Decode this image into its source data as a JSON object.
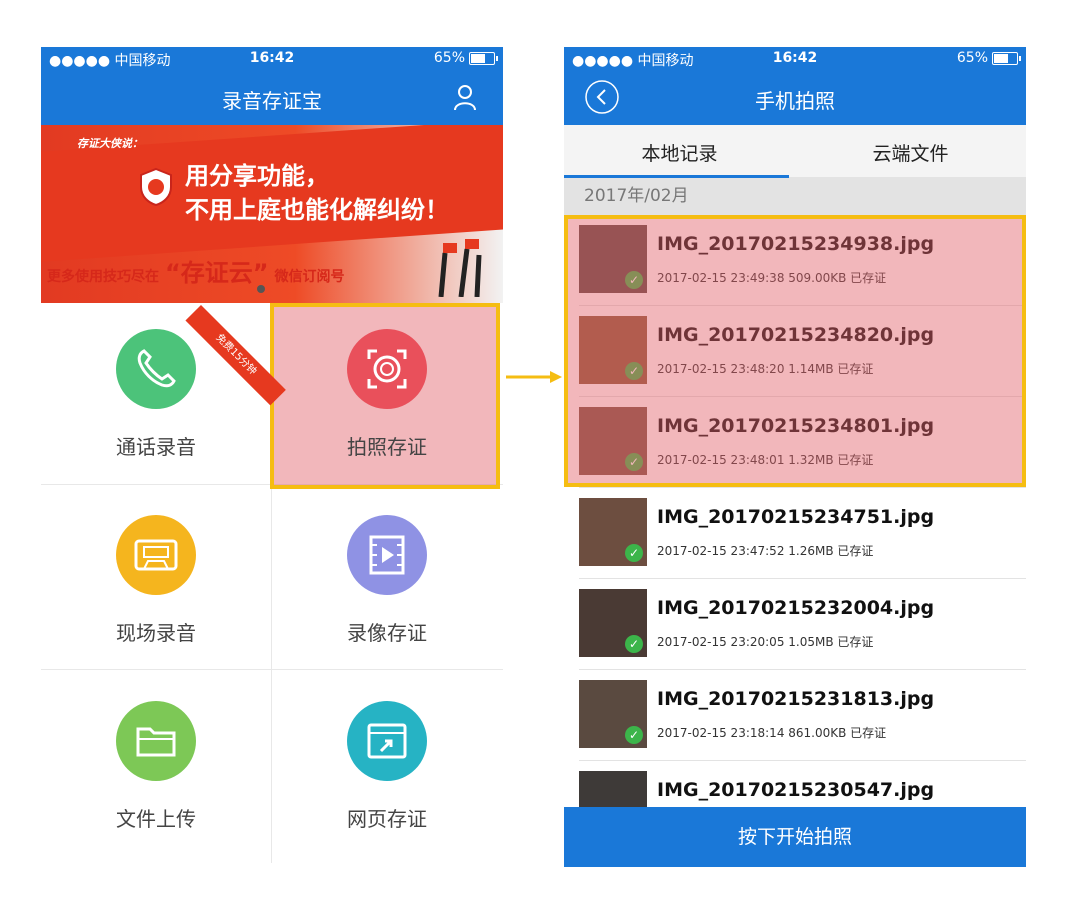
{
  "colors": {
    "primary": "#1a78d8",
    "highlight_border": "#f5bd12",
    "highlight_fill": "#e25f69",
    "check": "#3cb54a"
  },
  "left_phone": {
    "status": {
      "carrier": "●●●●● 中国移动",
      "time": "16:42",
      "battery": "65%",
      "battery_level": 0.65
    },
    "nav": {
      "title": "录音存证宝",
      "right_icon": "user-icon"
    },
    "banner": {
      "corner": "存证大侠说：",
      "headline_line1": "用分享功能，",
      "headline_line2": "不用上庭也能化解纠纷！",
      "sub_prefix": "更多使用技巧尽在",
      "sub_big": "“存证云”",
      "sub_suffix": "微信订阅号",
      "ribbon": "免费15分钟"
    },
    "grid": [
      {
        "label": "通话录音",
        "icon": "phone-icon",
        "color": "#4cc37a"
      },
      {
        "label": "拍照存证",
        "icon": "camera-icon",
        "color": "#e9505b"
      },
      {
        "label": "现场录音",
        "icon": "cassette-icon",
        "color": "#f5b51e"
      },
      {
        "label": "录像存证",
        "icon": "video-icon",
        "color": "#8f92e4"
      },
      {
        "label": "文件上传",
        "icon": "folder-icon",
        "color": "#7dc856"
      },
      {
        "label": "网页存证",
        "icon": "webpage-icon",
        "color": "#26b3c4"
      }
    ]
  },
  "right_phone": {
    "status": {
      "carrier": "●●●●● 中国移动",
      "time": "16:42",
      "battery": "65%",
      "battery_level": 0.65
    },
    "nav": {
      "title": "手机拍照",
      "left_icon": "back-icon"
    },
    "tabs": [
      {
        "label": "本地记录"
      },
      {
        "label": "云端文件"
      }
    ],
    "section": "2017年/02月",
    "files": [
      {
        "name": "IMG_20170215234938.jpg",
        "meta": "2017-02-15 23:49:38 509.00KB 已存证"
      },
      {
        "name": "IMG_20170215234820.jpg",
        "meta": "2017-02-15 23:48:20 1.14MB 已存证"
      },
      {
        "name": "IMG_20170215234801.jpg",
        "meta": "2017-02-15 23:48:01 1.32MB 已存证"
      },
      {
        "name": "IMG_20170215234751.jpg",
        "meta": "2017-02-15 23:47:52 1.26MB 已存证"
      },
      {
        "name": "IMG_20170215232004.jpg",
        "meta": "2017-02-15 23:20:05 1.05MB 已存证"
      },
      {
        "name": "IMG_20170215231813.jpg",
        "meta": "2017-02-15 23:18:14 861.00KB 已存证"
      },
      {
        "name": "IMG_20170215230547.jpg",
        "meta": ""
      }
    ],
    "bottom_button": "按下开始拍照"
  }
}
